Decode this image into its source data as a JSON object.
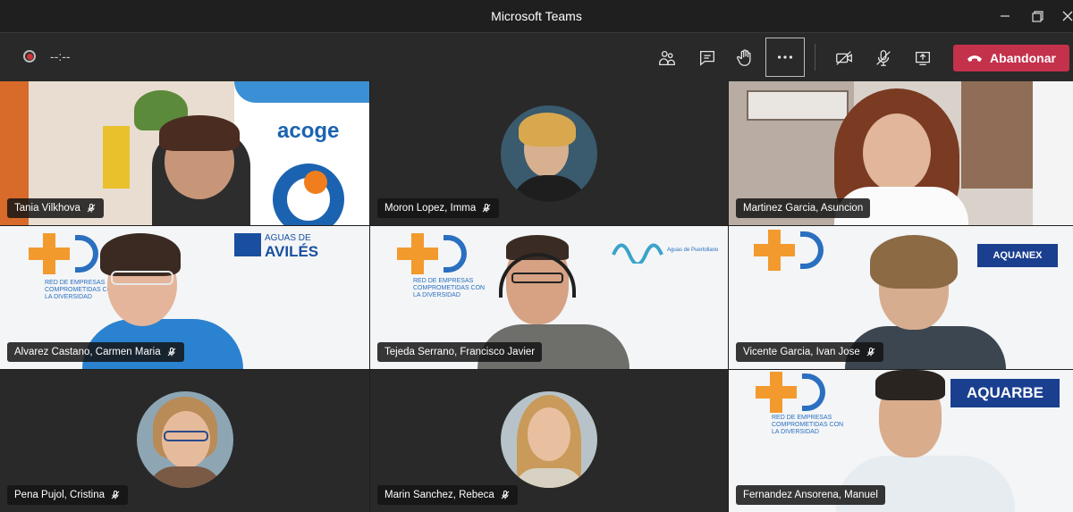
{
  "window": {
    "title": "Microsoft Teams"
  },
  "toolbar": {
    "timer": "--:--",
    "leave_label": "Abandonar",
    "icons": [
      "people-icon",
      "chat-icon",
      "raise-hand-icon",
      "more-icon",
      "camera-off-icon",
      "mic-off-icon",
      "share-screen-icon"
    ],
    "accent": "#c4314b"
  },
  "participants": [
    {
      "name": "Tania Vilkhova",
      "mic": "muted"
    },
    {
      "name": "Moron Lopez, Imma",
      "mic": "muted"
    },
    {
      "name": "Martinez Garcia, Asuncion",
      "mic": "on"
    },
    {
      "name": "Alvarez Castano, Carmen Maria",
      "mic": "muted"
    },
    {
      "name": "Tejeda Serrano, Francisco Javier",
      "mic": "on"
    },
    {
      "name": "Vicente Garcia, Ivan Jose",
      "mic": "muted"
    },
    {
      "name": "Pena Pujol, Cristina",
      "mic": "muted"
    },
    {
      "name": "Marin Sanchez, Rebeca",
      "mic": "muted"
    },
    {
      "name": "Fernandez Ansorena, Manuel",
      "mic": "on"
    }
  ],
  "backgrounds": {
    "acoge": "acoge",
    "avileS_line1": "AGUAS DE",
    "aviles_line2": "AVILÉS",
    "diversidad_line1": "RED DE EMPRESAS",
    "diversidad_line2": "COMPROMETIDAS CON",
    "diversidad_line3": "LA DIVERSIDAD",
    "aquanex": "AQUANEX",
    "aquarbe": "AQUARBE",
    "puertollano": "Aguas de Puertollano"
  }
}
